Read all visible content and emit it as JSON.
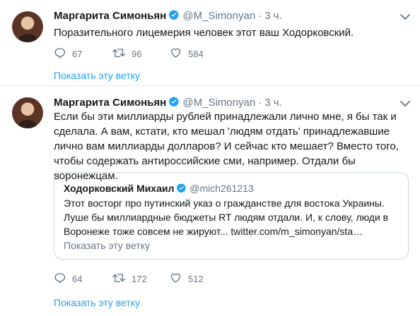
{
  "tweets": [
    {
      "author_name": "Маргарита Симоньян",
      "handle": "@M_Simonyan",
      "time": "3 ч.",
      "text": "Поразительного лицемерия человек этот ваш Ходорковский.",
      "replies": "67",
      "retweets": "96",
      "likes": "584",
      "thread_link": "Показать эту ветку"
    },
    {
      "author_name": "Маргарита Симоньян",
      "handle": "@M_Simonyan",
      "time": "3 ч.",
      "text": "Если бы эти миллиарды рублей принадлежали лично мне, я бы так и сделала. А вам, кстати, кто мешал 'людям отдать' принадлежавшие лично вам миллиарды долларов? И сейчас кто мешает? Вместо того, чтобы содержать антироссийские сми, например. Отдали бы воронежцам.",
      "replies": "64",
      "retweets": "172",
      "likes": "512",
      "thread_link": "Показать эту ветку",
      "quote": {
        "author_name": "Ходорковский Михаил",
        "handle": "@mich261213",
        "text": "Этот восторг про путинский указ о гражданстве для востока Украины. Луше бы миллиардные бюджеты RT людям отдали. И, к слову, люди в Воронеже тоже совсем не жируют... twitter.com/m_simonyan/sta…",
        "thread_link": "Показать эту ветку"
      }
    }
  ],
  "separator": "·",
  "colors": {
    "accent": "#1da1f2",
    "muted": "#657786",
    "text": "#14171a",
    "border": "#e6ecf0"
  }
}
